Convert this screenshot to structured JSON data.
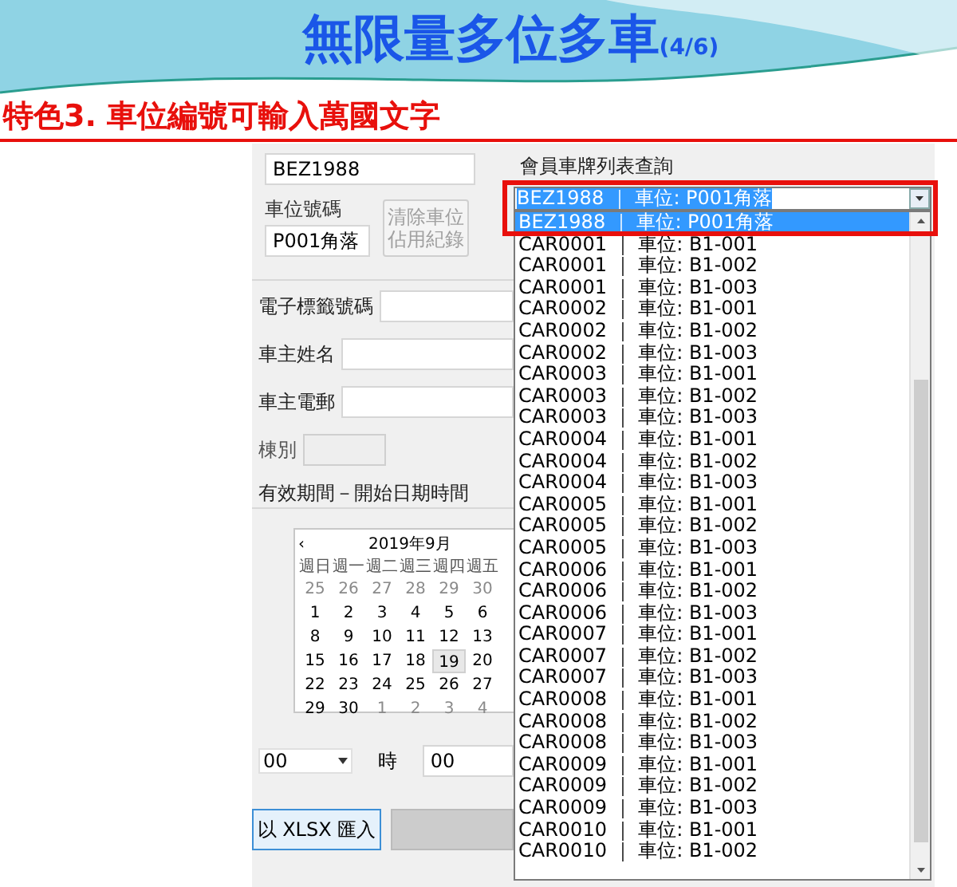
{
  "slide": {
    "title": "無限量多位多車",
    "title_counter": "(4/6)",
    "subtitle": "特色3. 車位編號可輸入萬國文字"
  },
  "form": {
    "plate_value": "BEZ1988",
    "slot_label": "車位號碼",
    "slot_value": "P001角落",
    "clear_button": {
      "label": "清除車位佔用紀錄",
      "disabled": true
    },
    "fields": [
      {
        "label": "電子標籤號碼",
        "disabled": false
      },
      {
        "label": "車主姓名",
        "disabled": false
      },
      {
        "label": "車主電郵",
        "disabled": false
      },
      {
        "label": "棟別",
        "disabled": true
      }
    ],
    "period_label": "有效期間－開始日期時間",
    "calendar": {
      "prev": "‹",
      "month": "2019年9月",
      "weekdays": [
        "週日",
        "週一",
        "週二",
        "週三",
        "週四",
        "週五"
      ],
      "weeks": [
        [
          {
            "day": "25",
            "muted": true,
            "selected": false
          },
          {
            "day": "26",
            "muted": true,
            "selected": false
          },
          {
            "day": "27",
            "muted": true,
            "selected": false
          },
          {
            "day": "28",
            "muted": true,
            "selected": false
          },
          {
            "day": "29",
            "muted": true,
            "selected": false
          },
          {
            "day": "30",
            "muted": true,
            "selected": false
          }
        ],
        [
          {
            "day": "1",
            "muted": false,
            "selected": false
          },
          {
            "day": "2",
            "muted": false,
            "selected": false
          },
          {
            "day": "3",
            "muted": false,
            "selected": false
          },
          {
            "day": "4",
            "muted": false,
            "selected": false
          },
          {
            "day": "5",
            "muted": false,
            "selected": false
          },
          {
            "day": "6",
            "muted": false,
            "selected": false
          }
        ],
        [
          {
            "day": "8",
            "muted": false,
            "selected": false
          },
          {
            "day": "9",
            "muted": false,
            "selected": false
          },
          {
            "day": "10",
            "muted": false,
            "selected": false
          },
          {
            "day": "11",
            "muted": false,
            "selected": false
          },
          {
            "day": "12",
            "muted": false,
            "selected": false
          },
          {
            "day": "13",
            "muted": false,
            "selected": false
          }
        ],
        [
          {
            "day": "15",
            "muted": false,
            "selected": false
          },
          {
            "day": "16",
            "muted": false,
            "selected": false
          },
          {
            "day": "17",
            "muted": false,
            "selected": false
          },
          {
            "day": "18",
            "muted": false,
            "selected": false
          },
          {
            "day": "19",
            "muted": false,
            "selected": true
          },
          {
            "day": "20",
            "muted": false,
            "selected": false
          }
        ],
        [
          {
            "day": "22",
            "muted": false,
            "selected": false
          },
          {
            "day": "23",
            "muted": false,
            "selected": false
          },
          {
            "day": "24",
            "muted": false,
            "selected": false
          },
          {
            "day": "25",
            "muted": false,
            "selected": false
          },
          {
            "day": "26",
            "muted": false,
            "selected": false
          },
          {
            "day": "27",
            "muted": false,
            "selected": false
          }
        ],
        [
          {
            "day": "29",
            "muted": false,
            "selected": false
          },
          {
            "day": "30",
            "muted": false,
            "selected": false
          },
          {
            "day": "1",
            "muted": true,
            "selected": false
          },
          {
            "day": "2",
            "muted": true,
            "selected": false
          },
          {
            "day": "3",
            "muted": true,
            "selected": false
          },
          {
            "day": "4",
            "muted": true,
            "selected": false
          }
        ]
      ]
    },
    "hour_value": "00",
    "hour_label": "時",
    "minute_value": "00",
    "import_button": "以 XLSX 匯入"
  },
  "plate_list": {
    "label": "會員車牌列表查詢",
    "combo_value": "BEZ1988 ｜ 車位: P001角落",
    "highlighted": true,
    "items": [
      {
        "text": "BEZ1988 ｜ 車位: P001角落",
        "selected": true
      },
      {
        "text": "CAR0001 ｜ 車位: B1-001",
        "selected": false
      },
      {
        "text": "CAR0001 ｜ 車位: B1-002",
        "selected": false
      },
      {
        "text": "CAR0001 ｜ 車位: B1-003",
        "selected": false
      },
      {
        "text": "CAR0002 ｜ 車位: B1-001",
        "selected": false
      },
      {
        "text": "CAR0002 ｜ 車位: B1-002",
        "selected": false
      },
      {
        "text": "CAR0002 ｜ 車位: B1-003",
        "selected": false
      },
      {
        "text": "CAR0003 ｜ 車位: B1-001",
        "selected": false
      },
      {
        "text": "CAR0003 ｜ 車位: B1-002",
        "selected": false
      },
      {
        "text": "CAR0003 ｜ 車位: B1-003",
        "selected": false
      },
      {
        "text": "CAR0004 ｜ 車位: B1-001",
        "selected": false
      },
      {
        "text": "CAR0004 ｜ 車位: B1-002",
        "selected": false
      },
      {
        "text": "CAR0004 ｜ 車位: B1-003",
        "selected": false
      },
      {
        "text": "CAR0005 ｜ 車位: B1-001",
        "selected": false
      },
      {
        "text": "CAR0005 ｜ 車位: B1-002",
        "selected": false
      },
      {
        "text": "CAR0005 ｜ 車位: B1-003",
        "selected": false
      },
      {
        "text": "CAR0006 ｜ 車位: B1-001",
        "selected": false
      },
      {
        "text": "CAR0006 ｜ 車位: B1-002",
        "selected": false
      },
      {
        "text": "CAR0006 ｜ 車位: B1-003",
        "selected": false
      },
      {
        "text": "CAR0007 ｜ 車位: B1-001",
        "selected": false
      },
      {
        "text": "CAR0007 ｜ 車位: B1-002",
        "selected": false
      },
      {
        "text": "CAR0007 ｜ 車位: B1-003",
        "selected": false
      },
      {
        "text": "CAR0008 ｜ 車位: B1-001",
        "selected": false
      },
      {
        "text": "CAR0008 ｜ 車位: B1-002",
        "selected": false
      },
      {
        "text": "CAR0008 ｜ 車位: B1-003",
        "selected": false
      },
      {
        "text": "CAR0009 ｜ 車位: B1-001",
        "selected": false
      },
      {
        "text": "CAR0009 ｜ 車位: B1-002",
        "selected": false
      },
      {
        "text": "CAR0009 ｜ 車位: B1-003",
        "selected": false
      },
      {
        "text": "CAR0010 ｜ 車位: B1-001",
        "selected": false
      },
      {
        "text": "CAR0010 ｜ 車位: B1-002",
        "selected": false
      }
    ]
  }
}
